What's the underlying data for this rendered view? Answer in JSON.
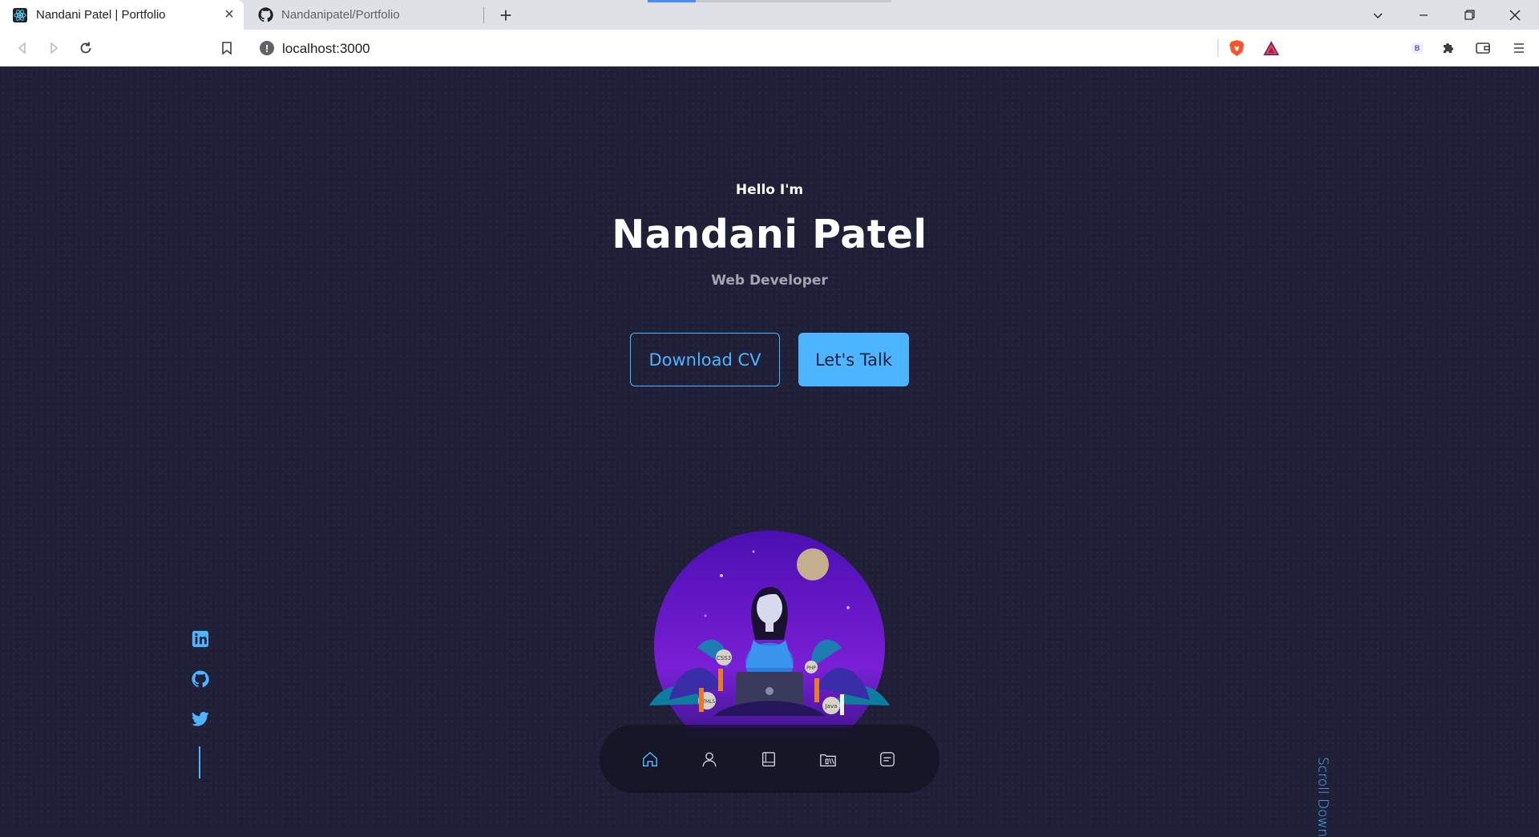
{
  "browser": {
    "tabs": [
      {
        "title": "Nandani Patel | Portfolio",
        "icon": "react-icon",
        "active": true
      },
      {
        "title": "Nandanipatel/Portfolio",
        "icon": "github-icon",
        "active": false
      }
    ],
    "url": "localhost:3000",
    "extension_badge": "B"
  },
  "hero": {
    "greeting": "Hello I'm",
    "name": "Nandani Patel",
    "role": "Web Developer",
    "download_cv_label": "Download CV",
    "lets_talk_label": "Let's Talk"
  },
  "socials": [
    "linkedin-icon",
    "github-icon",
    "twitter-icon"
  ],
  "scroll_down_label": "Scroll Down",
  "bottom_nav": [
    "home-icon",
    "user-icon",
    "book-icon",
    "portfolio-icon",
    "message-icon"
  ],
  "illustration_badges": [
    "CSS3",
    "HTML5",
    "Java",
    "PHP"
  ],
  "colors": {
    "accent": "#4db5ff",
    "background": "#1f1f38"
  }
}
